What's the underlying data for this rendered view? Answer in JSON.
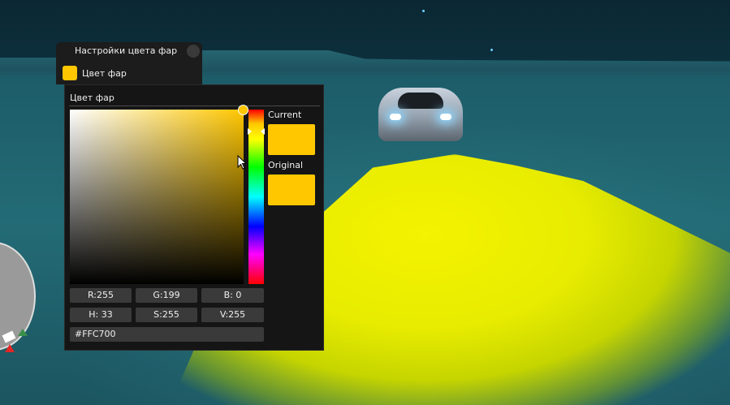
{
  "main_window": {
    "title": "Настройки цвета фар",
    "color_button_label": "Цвет фар"
  },
  "picker": {
    "title": "Цвет фар",
    "current_label": "Current",
    "original_label": "Original",
    "current_color": "#FFC700",
    "original_color": "#FFC700",
    "rgb": {
      "r": "R:255",
      "g": "G:199",
      "b": "B:  0"
    },
    "hsv": {
      "h": "H: 33",
      "s": "S:255",
      "v": "V:255"
    },
    "hex": "#FFC700"
  },
  "colors": {
    "accent": "#FFC700",
    "panel_bg": "#151515",
    "field_bg": "#3a3a3a",
    "headlight_beam": "#e8ec00"
  }
}
